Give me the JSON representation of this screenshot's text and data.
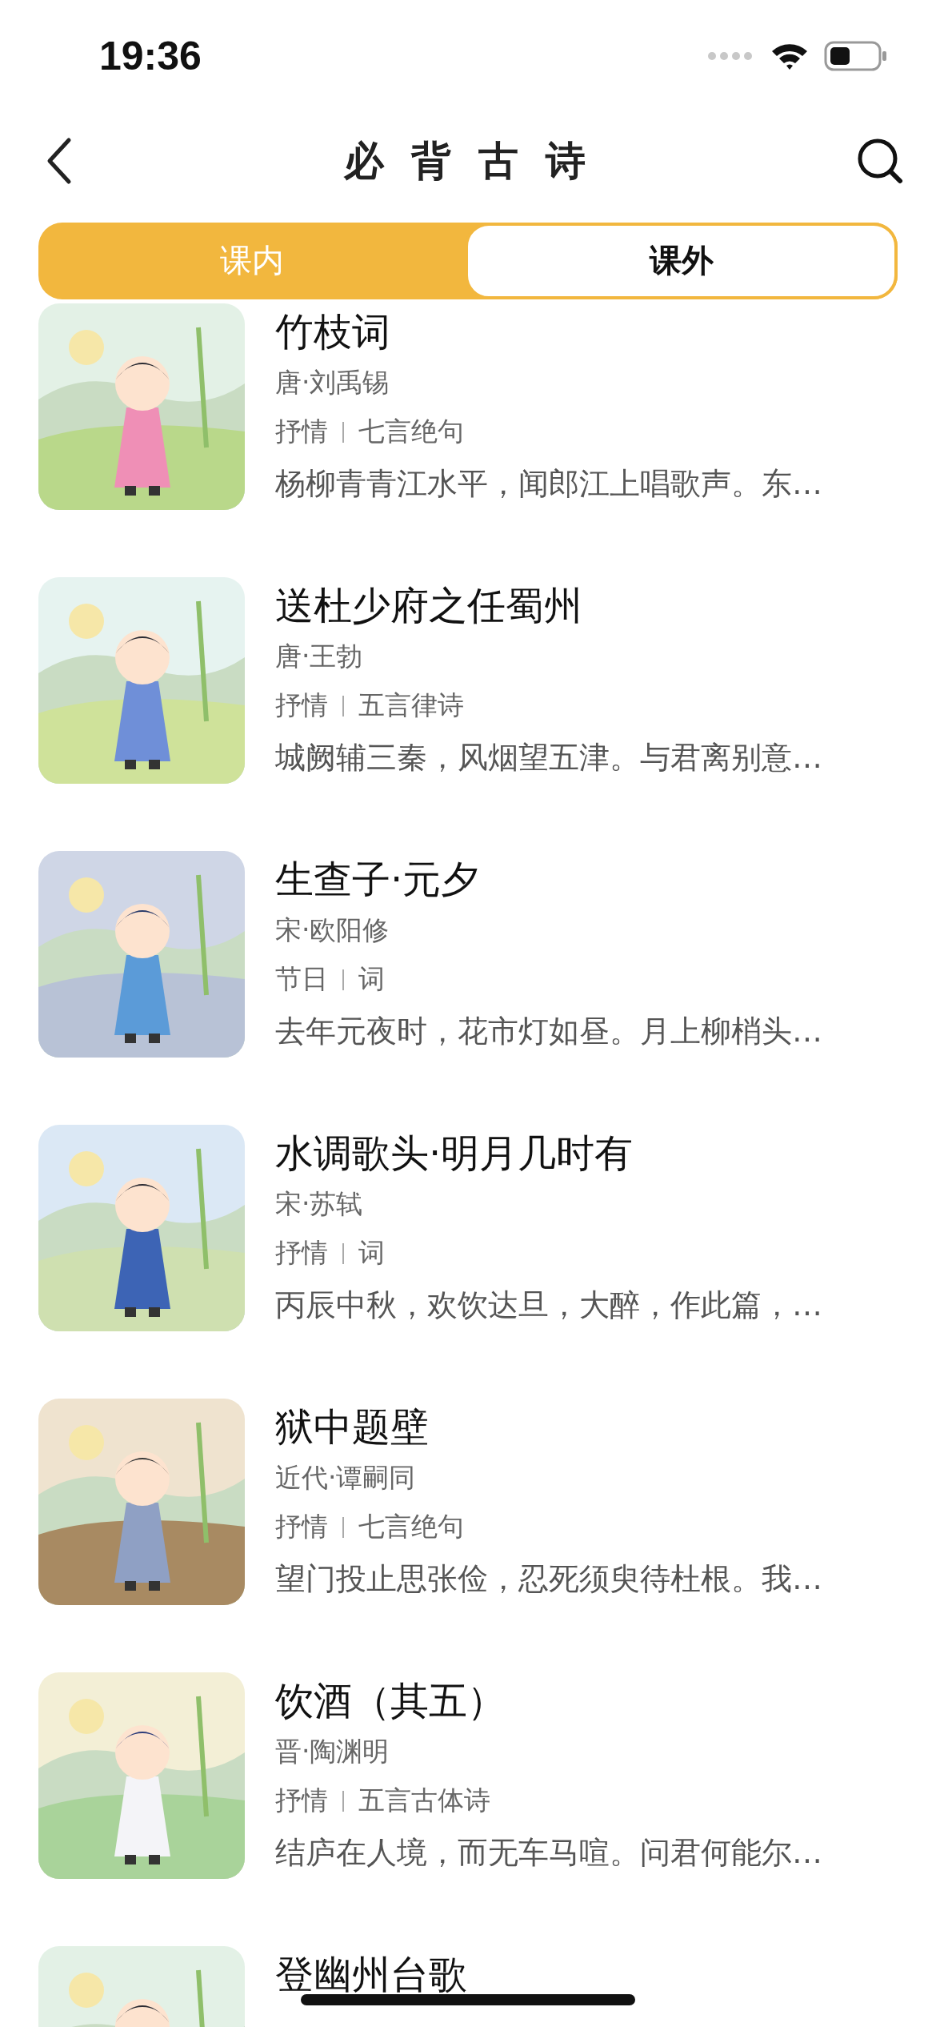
{
  "status_bar": {
    "time": "19:36"
  },
  "nav": {
    "title": "必背古诗"
  },
  "tabs": [
    {
      "label": "课内",
      "selected": false
    },
    {
      "label": "课外",
      "selected": true
    }
  ],
  "poems": [
    {
      "title": "竹枝词",
      "author": "唐·刘禹锡",
      "tags": [
        "抒情",
        "七言绝句"
      ],
      "excerpt": "杨柳青青江水平，闻郎江上唱歌声。东…"
    },
    {
      "title": "送杜少府之任蜀州",
      "author": "唐·王勃",
      "tags": [
        "抒情",
        "五言律诗"
      ],
      "excerpt": "城阙辅三秦，风烟望五津。与君离别意…"
    },
    {
      "title": "生查子·元夕",
      "author": "宋·欧阳修",
      "tags": [
        "节日",
        "词"
      ],
      "excerpt": "去年元夜时，花市灯如昼。月上柳梢头…"
    },
    {
      "title": "水调歌头·明月几时有",
      "author": "宋·苏轼",
      "tags": [
        "抒情",
        "词"
      ],
      "excerpt": "丙辰中秋，欢饮达旦，大醉，作此篇，…"
    },
    {
      "title": "狱中题壁",
      "author": "近代·谭嗣同",
      "tags": [
        "抒情",
        "七言绝句"
      ],
      "excerpt": "望门投止思张俭，忍死须臾待杜根。我…"
    },
    {
      "title": "饮酒（其五）",
      "author": "晋·陶渊明",
      "tags": [
        "抒情",
        "五言古体诗"
      ],
      "excerpt": "结庐在人境，而无车马喧。问君何能尔…"
    },
    {
      "title": "登幽州台歌"
    }
  ]
}
